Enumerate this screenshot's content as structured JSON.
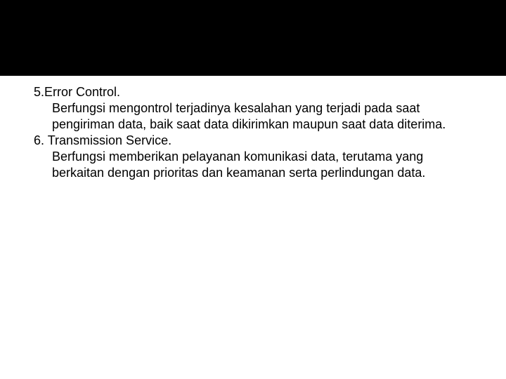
{
  "items": [
    {
      "number": "5.",
      "title": "Error Control.",
      "body": "Berfungsi mengontrol terjadinya kesalahan yang terjadi pada saat pengiriman data, baik saat data dikirimkan maupun saat data diterima."
    },
    {
      "number": "6.",
      "title": "Transmission Service.",
      "body": "Berfungsi memberikan pelayanan komunikasi data, terutama yang berkaitan dengan prioritas dan keamanan serta perlindungan data."
    }
  ]
}
